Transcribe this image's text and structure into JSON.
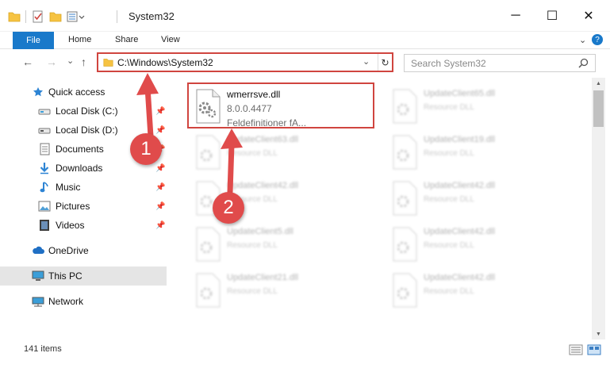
{
  "window": {
    "title": "System32",
    "minimize_glyph": "─",
    "maximize_glyph": "☐",
    "close_glyph": "✕"
  },
  "ribbon": {
    "file": "File",
    "home": "Home",
    "share": "Share",
    "view": "View",
    "expand_glyph": "⌄",
    "help_glyph": "?"
  },
  "nav": {
    "back_glyph": "←",
    "forward_glyph": "→",
    "recent_glyph": "⌄",
    "up_glyph": "↑",
    "address": "C:\\Windows\\System32",
    "dropdown_glyph": "⌄",
    "refresh_glyph": "↻",
    "search_placeholder": "Search System32"
  },
  "sidebar": {
    "items": [
      {
        "label": "Quick access",
        "icon": "star-icon"
      },
      {
        "label": "Local Disk (C:)",
        "icon": "drive-icon",
        "pinned": true
      },
      {
        "label": "Local Disk (D:)",
        "icon": "drive-icon",
        "pinned": true
      },
      {
        "label": "Documents",
        "icon": "documents-icon",
        "pinned": true
      },
      {
        "label": "Downloads",
        "icon": "downloads-icon",
        "pinned": true
      },
      {
        "label": "Music",
        "icon": "music-icon",
        "pinned": true
      },
      {
        "label": "Pictures",
        "icon": "pictures-icon",
        "pinned": true
      },
      {
        "label": "Videos",
        "icon": "videos-icon",
        "pinned": true
      },
      {
        "label": "OneDrive",
        "icon": "cloud-icon"
      },
      {
        "label": "This PC",
        "icon": "computer-icon",
        "selected": true
      },
      {
        "label": "Network",
        "icon": "network-icon"
      }
    ]
  },
  "files": [
    {
      "name": "wmerrsve.dll",
      "version": "8.0.0.4477",
      "description": "Feldefinitioner fA...",
      "highlighted": true
    },
    {
      "name": "UpdateClient65.dll",
      "version": "Resource DLL",
      "faded": true
    },
    {
      "name": "UpdateClient63.dll",
      "version": "Resource DLL",
      "faded": true
    },
    {
      "name": "UpdateClient19.dll",
      "version": "Resource DLL",
      "faded": true
    },
    {
      "name": "UpdateClient42.dll",
      "version": "Resource DLL",
      "faded": true
    },
    {
      "name": "UpdateClient42.dll",
      "version": "Resource DLL",
      "faded": true
    },
    {
      "name": "UpdateClient5.dll",
      "version": "Resource DLL",
      "faded": true
    },
    {
      "name": "UpdateClient42.dll",
      "version": "Resource DLL",
      "faded": true
    },
    {
      "name": "UpdateClient21.dll",
      "version": "Resource DLL",
      "faded": true
    },
    {
      "name": "UpdateClient42.dll",
      "version": "Resource DLL",
      "faded": true
    }
  ],
  "status": {
    "item_count": "141 items"
  },
  "annotations": {
    "step1": "1",
    "step2": "2"
  },
  "colors": {
    "accent": "#1979ca",
    "highlight_red": "#d0453f",
    "callout_red": "#e04b4b",
    "selected_bg": "#e5e5e5"
  }
}
